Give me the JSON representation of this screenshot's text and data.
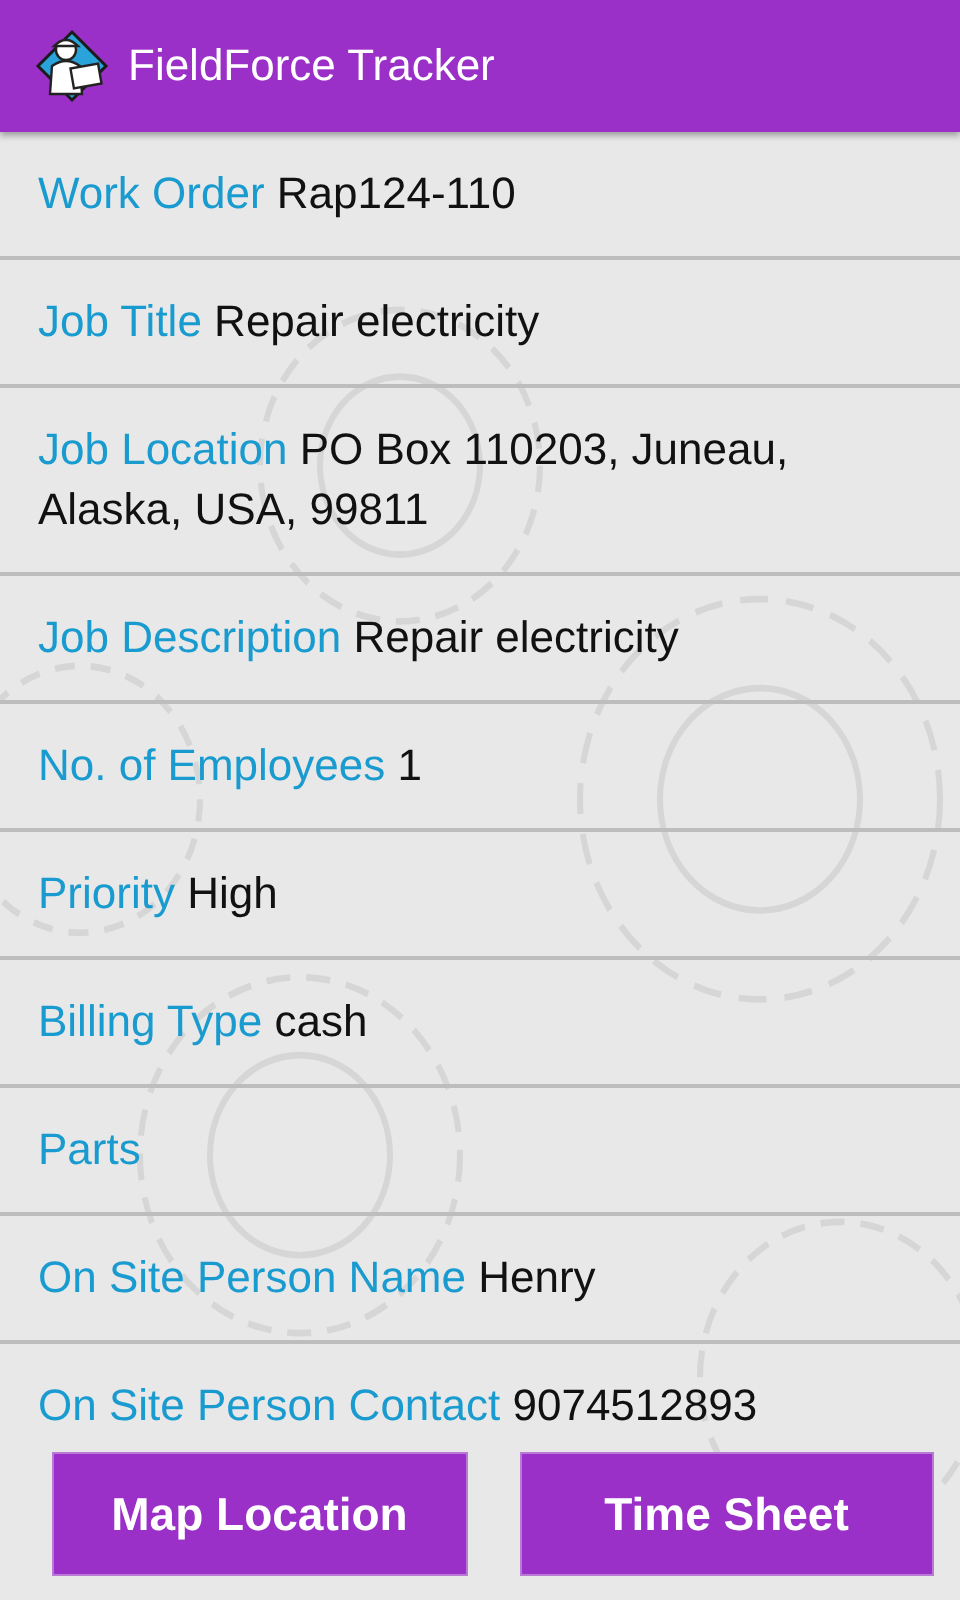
{
  "app_bar": {
    "title": "FieldForce Tracker"
  },
  "details": [
    {
      "label": "Work Order",
      "value": "Rap124-110"
    },
    {
      "label": "Job Title",
      "value": "Repair electricity"
    },
    {
      "label": "Job Location",
      "value": "PO Box 110203, Juneau, Alaska, USA, 99811"
    },
    {
      "label": "Job Description",
      "value": "Repair electricity"
    },
    {
      "label": "No. of Employees",
      "value": "1"
    },
    {
      "label": "Priority",
      "value": "High"
    },
    {
      "label": "Billing Type",
      "value": "cash"
    },
    {
      "label": "Parts"
    },
    {
      "label": "On Site Person Name",
      "value": "Henry"
    },
    {
      "label": "On Site Person Contact",
      "value": "9074512893"
    }
  ],
  "buttons": [
    "Map Location",
    "Time Sheet"
  ]
}
